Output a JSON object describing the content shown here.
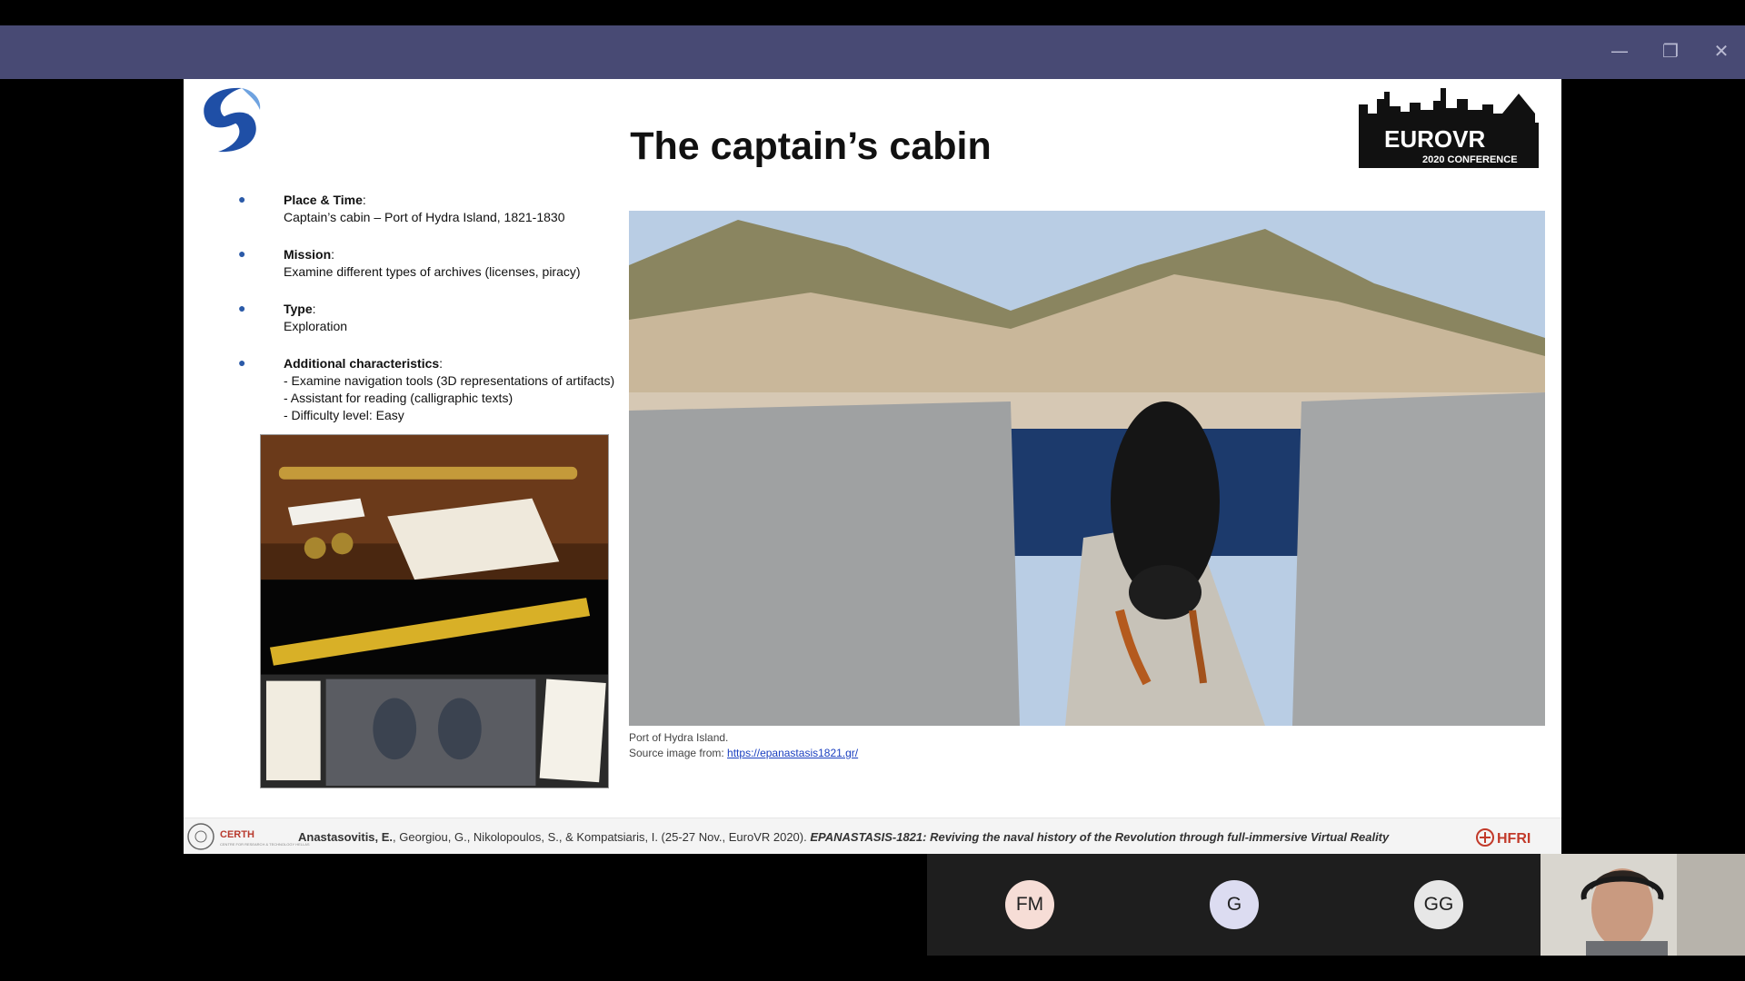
{
  "window": {
    "minimize_label": "—",
    "restore_label": "❐",
    "close_label": "✕"
  },
  "slide": {
    "title": "The captain’s cabin",
    "logo_right": {
      "line1": "EUROVR",
      "line2": "2020 CONFERENCE"
    },
    "bullets": [
      {
        "heading": "Place & Time",
        "lines": [
          "Captain’s cabin – Port of Hydra Island, 1821-1830"
        ]
      },
      {
        "heading": "Mission",
        "lines": [
          "Examine different types of archives (licenses, piracy)"
        ]
      },
      {
        "heading": "Type",
        "lines": [
          "Exploration"
        ]
      },
      {
        "heading": "Additional characteristics",
        "lines": [
          "- Examine navigation tools (3D representations of artifacts)",
          "- Assistant for reading (calligraphic texts)",
          "- Difficulty level: Easy"
        ]
      }
    ],
    "caption": {
      "line1": "Port of Hydra Island.",
      "source_prefix": "Source image from: ",
      "source_link": "https://epanastasis1821.gr/"
    },
    "footer": {
      "certh": "CERTH",
      "certh_sub": "CENTRE FOR RESEARCH & TECHNOLOGY HELLAS",
      "author_bold": "Anastasovitis, E.",
      "citation_rest": ", Georgiou, G., Nikolopoulos, S., & Kompatsiaris, I. (25-27 Nov., EuroVR 2020). ",
      "paper_title": "EPANASTASIS-1821: Reviving the naval history of the Revolution through full-immersive Virtual Reality",
      "hfri": "HFRI"
    }
  },
  "participants": [
    {
      "initials": "FM",
      "bg": "#f6ddd6",
      "fg": "#222222"
    },
    {
      "initials": "G",
      "bg": "#dcdcf1",
      "fg": "#222222"
    },
    {
      "initials": "GG",
      "bg": "#e7e7e7",
      "fg": "#222222"
    }
  ]
}
